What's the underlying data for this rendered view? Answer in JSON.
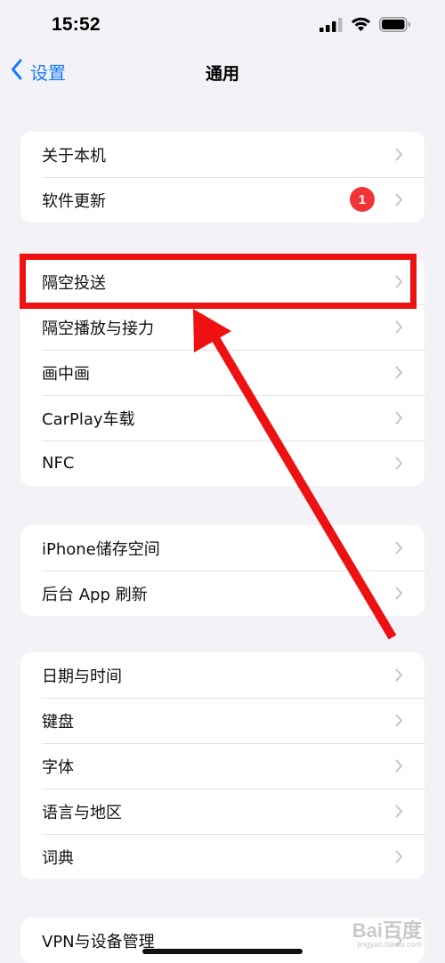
{
  "status_bar": {
    "time": "15:52",
    "icons": [
      "cellular-signal-icon",
      "wifi-icon",
      "battery-icon"
    ]
  },
  "nav": {
    "back_label": "设置",
    "title": "通用"
  },
  "groups": [
    {
      "items": [
        {
          "label": "关于本机"
        },
        {
          "label": "软件更新",
          "badge": "1"
        }
      ]
    },
    {
      "items": [
        {
          "label": "隔空投送"
        },
        {
          "label": "隔空播放与接力"
        },
        {
          "label": "画中画"
        },
        {
          "label": "CarPlay车载"
        },
        {
          "label": "NFC"
        }
      ]
    },
    {
      "items": [
        {
          "label": "iPhone储存空间"
        },
        {
          "label": "后台 App 刷新"
        }
      ]
    },
    {
      "items": [
        {
          "label": "日期与时间"
        },
        {
          "label": "键盘"
        },
        {
          "label": "字体"
        },
        {
          "label": "语言与地区"
        },
        {
          "label": "词典"
        }
      ]
    },
    {
      "items": [
        {
          "label": "VPN与设备管理"
        }
      ]
    }
  ],
  "annotation": {
    "color": "#ee1111",
    "highlighted_item": "隔空投送"
  },
  "colors": {
    "accent": "#1a7cf5",
    "badge": "#f2333a",
    "background": "#f2f2f7"
  },
  "watermark": {
    "text": "Bai百度",
    "sub": "jingyan.baidu.com"
  }
}
